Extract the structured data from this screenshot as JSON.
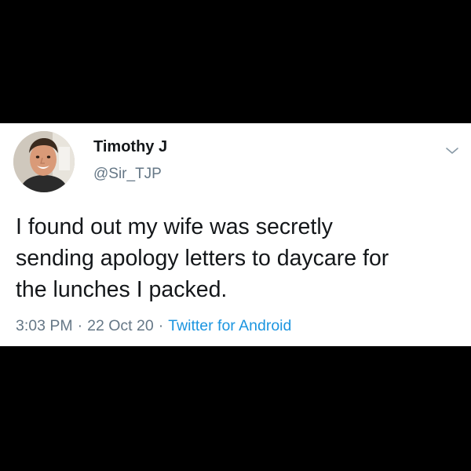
{
  "tweet": {
    "display_name": "Timothy J",
    "handle": "@Sir_TJP",
    "text_lines": [
      "I found out my wife was secretly",
      "sending apology letters to daycare for",
      "the lunches I packed."
    ],
    "time": "3:03 PM",
    "separator": "·",
    "date": "22 Oct 20",
    "source": "Twitter for Android",
    "menu_icon": "chevron-down-icon",
    "avatar_icon": "profile-photo"
  },
  "colors": {
    "background": "#000000",
    "card": "#ffffff",
    "text": "#14171a",
    "muted": "#657786",
    "link": "#1b95e0"
  }
}
